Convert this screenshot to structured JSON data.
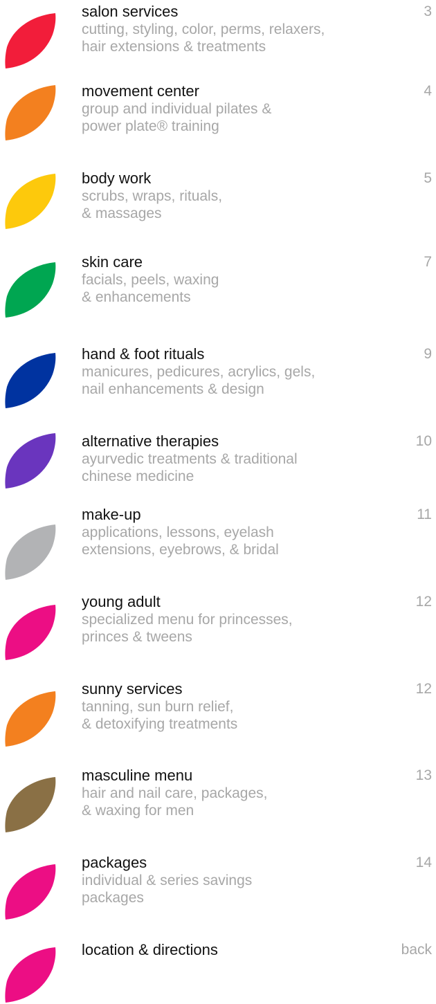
{
  "items": [
    {
      "title": "salon services",
      "line1": "cutting, styling, color, perms, relaxers,",
      "line2": "hair extensions & treatments",
      "page": "3",
      "color": "#f21d3a",
      "icon": "leaf-icon"
    },
    {
      "title": "movement center",
      "line1": "group and individual pilates &",
      "line2": "power plate® training",
      "page": "4",
      "color": "#f3801f",
      "icon": "leaf-icon"
    },
    {
      "title": "body work",
      "line1": "scrubs, wraps, rituals,",
      "line2": "& massages",
      "page": "5",
      "color": "#fdc90c",
      "icon": "leaf-icon"
    },
    {
      "title": "skin care",
      "line1": "facials, peels, waxing",
      "line2": "& enhancements",
      "page": "7",
      "color": "#00a651",
      "icon": "leaf-icon"
    },
    {
      "title": "hand & foot rituals",
      "line1": "manicures, pedicures, acrylics, gels,",
      "line2": "nail enhancements & design",
      "page": "9",
      "color": "#0033a0",
      "icon": "leaf-icon"
    },
    {
      "title": "alternative therapies",
      "line1": "ayurvedic treatments & traditional",
      "line2": "chinese medicine",
      "page": "10",
      "color": "#6a35be",
      "icon": "leaf-icon"
    },
    {
      "title": "make-up",
      "line1": "applications, lessons, eyelash",
      "line2": "extensions, eyebrows, & bridal",
      "page": "11",
      "color": "#b2b3b5",
      "icon": "leaf-icon"
    },
    {
      "title": "young adult",
      "line1": "specialized menu for princesses,",
      "line2": "princes & tweens",
      "page": "12",
      "color": "#ec0e84",
      "icon": "leaf-icon"
    },
    {
      "title": "sunny services",
      "line1": "tanning, sun burn relief,",
      "line2": "& detoxifying treatments",
      "page": "12",
      "color": "#f3801f",
      "icon": "leaf-icon"
    },
    {
      "title": "masculine menu",
      "line1": "hair and nail care, packages,",
      "line2": "& waxing for men",
      "page": "13",
      "color": "#8a7045",
      "icon": "leaf-icon"
    },
    {
      "title": "packages",
      "line1": "individual & series savings",
      "line2": "packages",
      "page": "14",
      "color": "#ec0e84",
      "icon": "leaf-icon"
    }
  ],
  "footer": {
    "title": "location & directions",
    "back_label": "back",
    "color": "#ec0e84",
    "icon": "leaf-icon"
  }
}
